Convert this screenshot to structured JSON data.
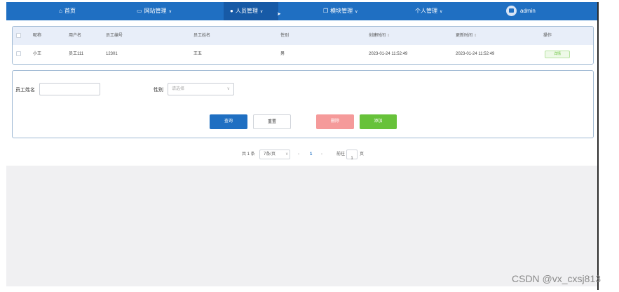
{
  "nav": {
    "home": "首页",
    "site_mgmt": "网站管理",
    "staff_mgmt": "人员管理",
    "module_mgmt": "模块管理",
    "personal_mgmt": "个人管理",
    "username": "admin",
    "colors": {
      "bar": "#1f6fc2",
      "active": "#175aa6"
    }
  },
  "table": {
    "headers": [
      "昵称",
      "用户名",
      "员工编号",
      "员工姓名",
      "性别",
      "创建时间",
      "更新时间",
      "操作"
    ],
    "rows": [
      {
        "nickname": "小王",
        "username": "员工111",
        "employee_no": "12301",
        "employee_name": "王五",
        "gender": "男",
        "created_at": "2023-01-24 11:52:49",
        "updated_at": "2023-01-24 11:52:49",
        "action": "详情"
      }
    ]
  },
  "search": {
    "name_label": "员工姓名",
    "name_value": "",
    "gender_label": "性别",
    "gender_placeholder": "请选择",
    "query_button": "查询",
    "reset_button": "重置",
    "delete_button": "删除",
    "add_button": "添加",
    "colors": {
      "query": "#1f6fc2",
      "delete": "#f59a9a",
      "add": "#67c23a"
    }
  },
  "pagination": {
    "total": "共 1 条",
    "page_size": "7条/页",
    "prev": "‹",
    "current_page": "1",
    "next": "›",
    "goto_label": "前往",
    "goto_value": "1",
    "page_suffix": "页"
  },
  "watermark": "CSDN @vx_cxsj813"
}
